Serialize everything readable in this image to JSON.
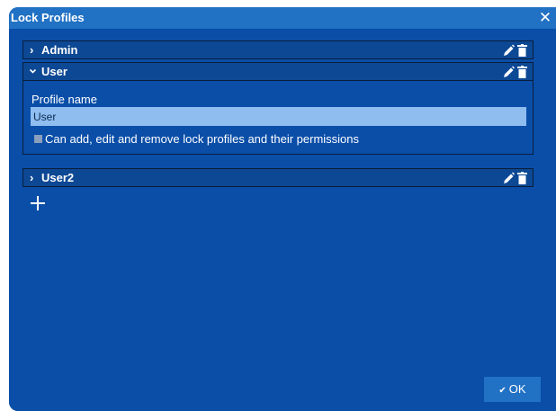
{
  "dialog": {
    "title": "Lock Profiles",
    "close_glyph": "✕"
  },
  "profiles": [
    {
      "name": "Admin",
      "expanded": false,
      "edit_icon": "pencil-icon",
      "delete_icon": "trash-icon"
    },
    {
      "name": "User",
      "expanded": true,
      "edit_icon": "pencil-icon",
      "delete_icon": "trash-icon"
    },
    {
      "name": "User2",
      "expanded": false,
      "edit_icon": "pencil-icon",
      "delete_icon": "trash-icon"
    }
  ],
  "expanded_profile": {
    "field_label": "Profile name",
    "field_value": "User",
    "permission_checked": false,
    "permission_label": "Can add, edit and remove lock profiles and their permissions"
  },
  "add_button": {
    "icon": "plus-icon"
  },
  "ok_button": {
    "label": "OK",
    "icon": "checkmark-icon"
  },
  "colors": {
    "dialog_bg": "#0a4ea8",
    "titlebar_bg": "#2171c4",
    "header_bg": "#0d4894",
    "input_bg": "#8fbdf0"
  }
}
